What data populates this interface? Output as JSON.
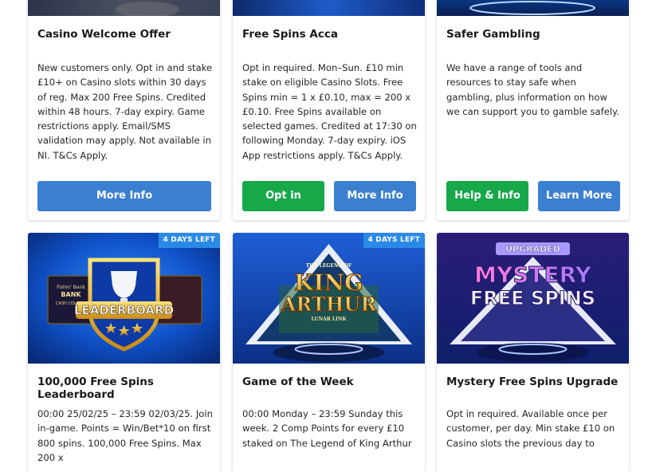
{
  "cards_top": [
    {
      "title": "Casino Welcome Offer",
      "description": "New customers only. Opt in and stake £10+ on Casino slots within 30 days of reg. Max 200 Free Spins. Credited within 48 hours. 7-day expiry. Game restrictions apply. Email/SMS validation may apply. Not available in NI. T&Cs Apply.",
      "buttons": [
        "More Info"
      ]
    },
    {
      "title": "Free Spins Acca",
      "description": "Opt in required. Mon–Sun. £10 min stake on eligible Casino Slots. Free Spins min = 1 x £0.10, max = 200 x £0.10. Free Spins available on selected games. Credited at 17:30 on following Monday. 7-day expiry. iOS App restrictions apply. T&Cs Apply.",
      "buttons": [
        "Opt in",
        "More Info"
      ]
    },
    {
      "title": "Safer Gambling",
      "description": "We have a range of tools and resources to stay safe when gambling, plus information on how we can support you to gamble safely.",
      "buttons": [
        "Help & Info",
        "Learn More"
      ]
    }
  ],
  "cards_bottom": [
    {
      "badge": "4 DAYS LEFT",
      "art": {
        "bank_line1": "Fishin' Bank",
        "bank_line2": "BANK",
        "bank_line3": "CASH COLLECT",
        "label": "LEADERBOARD"
      },
      "title": "100,000 Free Spins Leaderboard",
      "description": "00:00 25/02/25 – 23:59 02/03/25. Join in-game. Points = Win/Bet*10 on first 800 spins. 100,000 Free Spins. Max 200 x"
    },
    {
      "badge": "4 DAYS LEFT",
      "art": {
        "small": "THE LEGEND OF",
        "line1": "KING",
        "line2": "ARTHUR",
        "sub": "LUNAR LINK"
      },
      "title": "Game of the Week",
      "description": "00:00 Monday – 23:59 Sunday this week. 2 Comp Points for every £10 staked on The Legend of King Arthur"
    },
    {
      "art": {
        "tag": "UPGRADED",
        "line1": "MYSTERY",
        "line2": "FREE SPINS"
      },
      "title": "Mystery Free Spins Upgrade",
      "description": "Opt in required. Available once per customer, per day. Min stake £10 on Casino slots the previous day to"
    }
  ],
  "colors": {
    "button_blue": "#3b7fd1",
    "button_green": "#17a84a",
    "badge_blue": "#2b8ae6"
  }
}
